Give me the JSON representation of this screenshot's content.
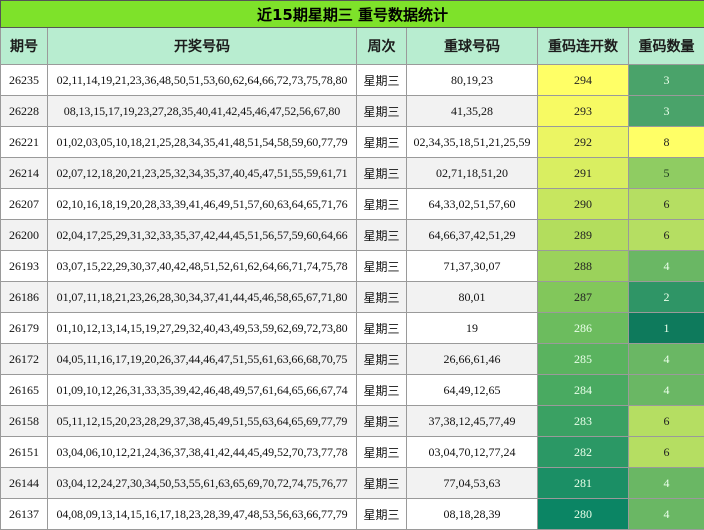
{
  "title": "近15期星期三 重号数据统计",
  "headers": {
    "period": "期号",
    "numbers": "开奖号码",
    "weekday": "周次",
    "repeat_numbers": "重球号码",
    "streak": "重码连开数",
    "count": "重码数量"
  },
  "colors": {
    "title_bg": "#7ee22a",
    "header_bg": "#b8edd0"
  },
  "rows": [
    {
      "period": "26235",
      "numbers": "02,11,14,19,21,23,36,48,50,51,53,60,62,64,66,72,73,75,78,80",
      "weekday": "星期三",
      "repeat": "80,19,23",
      "streak": "294",
      "count": "3",
      "streak_color": "#ffff66",
      "streak_text": "#222",
      "count_color": "#4aa36a",
      "count_text": "#eaffea"
    },
    {
      "period": "26228",
      "numbers": "08,13,15,17,19,23,27,28,35,40,41,42,45,46,47,52,56,67,80",
      "weekday": "星期三",
      "repeat": "41,35,28",
      "streak": "293",
      "count": "3",
      "streak_color": "#f7fa63",
      "streak_text": "#222",
      "count_color": "#4aa36a",
      "count_text": "#eaffea"
    },
    {
      "period": "26221",
      "numbers": "01,02,03,05,10,18,21,25,28,34,35,41,48,51,54,58,59,60,77,79",
      "weekday": "星期三",
      "repeat": "02,34,35,18,51,21,25,59",
      "streak": "292",
      "count": "8",
      "streak_color": "#ebf563",
      "streak_text": "#222",
      "count_color": "#ffff66",
      "count_text": "#222"
    },
    {
      "period": "26214",
      "numbers": "02,07,12,18,20,21,23,25,32,34,35,37,40,45,47,51,55,59,61,71",
      "weekday": "星期三",
      "repeat": "02,71,18,51,20",
      "streak": "291",
      "count": "5",
      "streak_color": "#d9ee61",
      "streak_text": "#222",
      "count_color": "#8fcc62",
      "count_text": "#1e3a1e"
    },
    {
      "period": "26207",
      "numbers": "02,10,16,18,19,20,28,33,39,41,46,49,51,57,60,63,64,65,71,76",
      "weekday": "星期三",
      "repeat": "64,33,02,51,57,60",
      "streak": "290",
      "count": "6",
      "streak_color": "#c7e65f",
      "streak_text": "#222",
      "count_color": "#b5de62",
      "count_text": "#222"
    },
    {
      "period": "26200",
      "numbers": "02,04,17,25,29,31,32,33,35,37,42,44,45,51,56,57,59,60,64,66",
      "weekday": "星期三",
      "repeat": "64,66,37,42,51,29",
      "streak": "289",
      "count": "6",
      "streak_color": "#b3dd5d",
      "streak_text": "#222",
      "count_color": "#b5de62",
      "count_text": "#222"
    },
    {
      "period": "26193",
      "numbers": "03,07,15,22,29,30,37,40,42,48,51,52,61,62,64,66,71,74,75,78",
      "weekday": "星期三",
      "repeat": "71,37,30,07",
      "streak": "288",
      "count": "4",
      "streak_color": "#9bd25b",
      "streak_text": "#222",
      "count_color": "#6ab764",
      "count_text": "#eaffea"
    },
    {
      "period": "26186",
      "numbers": "01,07,11,18,21,23,26,28,30,34,37,41,44,45,46,58,65,67,71,80",
      "weekday": "星期三",
      "repeat": "80,01",
      "streak": "287",
      "count": "2",
      "streak_color": "#82c75b",
      "streak_text": "#222",
      "count_color": "#2f9566",
      "count_text": "#eaffea"
    },
    {
      "period": "26179",
      "numbers": "01,10,12,13,14,15,19,27,29,32,40,43,49,53,59,62,69,72,73,80",
      "weekday": "星期三",
      "repeat": "19",
      "streak": "286",
      "count": "1",
      "streak_color": "#6cbc5e",
      "streak_text": "#eaffea",
      "count_color": "#0e7a5c",
      "count_text": "#eaffea"
    },
    {
      "period": "26172",
      "numbers": "04,05,11,16,17,19,20,26,37,44,46,47,51,55,61,63,66,68,70,75",
      "weekday": "星期三",
      "repeat": "26,66,61,46",
      "streak": "285",
      "count": "4",
      "streak_color": "#5ab35f",
      "streak_text": "#eaffea",
      "count_color": "#6ab764",
      "count_text": "#eaffea"
    },
    {
      "period": "26165",
      "numbers": "01,09,10,12,26,31,33,35,39,42,46,48,49,57,61,64,65,66,67,74",
      "weekday": "星期三",
      "repeat": "64,49,12,65",
      "streak": "284",
      "count": "4",
      "streak_color": "#49aa61",
      "streak_text": "#eaffea",
      "count_color": "#6ab764",
      "count_text": "#eaffea"
    },
    {
      "period": "26158",
      "numbers": "05,11,12,15,20,23,28,29,37,38,45,49,51,55,63,64,65,69,77,79",
      "weekday": "星期三",
      "repeat": "37,38,12,45,77,49",
      "streak": "283",
      "count": "6",
      "streak_color": "#3aa163",
      "streak_text": "#eaffea",
      "count_color": "#b5de62",
      "count_text": "#222"
    },
    {
      "period": "26151",
      "numbers": "03,04,06,10,12,21,24,36,37,38,41,42,44,45,49,52,70,73,77,78",
      "weekday": "星期三",
      "repeat": "03,04,70,12,77,24",
      "streak": "282",
      "count": "6",
      "streak_color": "#2b9865",
      "streak_text": "#eaffea",
      "count_color": "#b5de62",
      "count_text": "#222"
    },
    {
      "period": "26144",
      "numbers": "03,04,12,24,27,30,34,50,53,55,61,63,65,69,70,72,74,75,76,77",
      "weekday": "星期三",
      "repeat": "77,04,53,63",
      "streak": "281",
      "count": "4",
      "streak_color": "#1b8f65",
      "streak_text": "#eaffea",
      "count_color": "#6ab764",
      "count_text": "#eaffea"
    },
    {
      "period": "26137",
      "numbers": "04,08,09,13,14,15,16,17,18,23,28,39,47,48,53,56,63,66,77,79",
      "weekday": "星期三",
      "repeat": "08,18,28,39",
      "streak": "280",
      "count": "4",
      "streak_color": "#0b8564",
      "streak_text": "#eaffea",
      "count_color": "#6ab764",
      "count_text": "#eaffea"
    }
  ]
}
